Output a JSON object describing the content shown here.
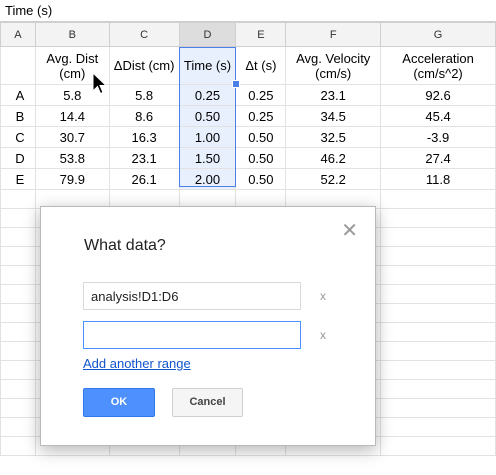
{
  "formula_bar": {
    "content": "Time (s)"
  },
  "columns": [
    "A",
    "B",
    "C",
    "D",
    "E",
    "F",
    "G"
  ],
  "header_row": {
    "B": "Avg. Dist (cm)",
    "C": "ΔDist (cm)",
    "D": "Time (s)",
    "E": "Δt (s)",
    "F": "Avg. Velocity (cm/s)",
    "G": "Acceleration (cm/s^2)"
  },
  "rows": [
    [
      "A",
      "5.8",
      "5.8",
      "0.25",
      "0.25",
      "23.1",
      "92.6"
    ],
    [
      "B",
      "14.4",
      "8.6",
      "0.50",
      "0.25",
      "34.5",
      "45.4"
    ],
    [
      "C",
      "30.7",
      "16.3",
      "1.00",
      "0.50",
      "32.5",
      "-3.9"
    ],
    [
      "D",
      "53.8",
      "23.1",
      "1.50",
      "0.50",
      "46.2",
      "27.4"
    ],
    [
      "E",
      "79.9",
      "26.1",
      "2.00",
      "0.50",
      "52.2",
      "11.8"
    ]
  ],
  "selected_column": "D",
  "dialog": {
    "title": "What data?",
    "close_glyph": "✕",
    "ranges": [
      {
        "value": "analysis!D1:D6",
        "placeholder": ""
      },
      {
        "value": "",
        "placeholder": ""
      }
    ],
    "remove_glyph": "x",
    "add_range_label": "Add another range",
    "ok_label": "OK",
    "cancel_label": "Cancel"
  },
  "colors": {
    "accent": "#4d90fe",
    "link": "#1155cc",
    "selection_fill": "#e8f0fe"
  }
}
